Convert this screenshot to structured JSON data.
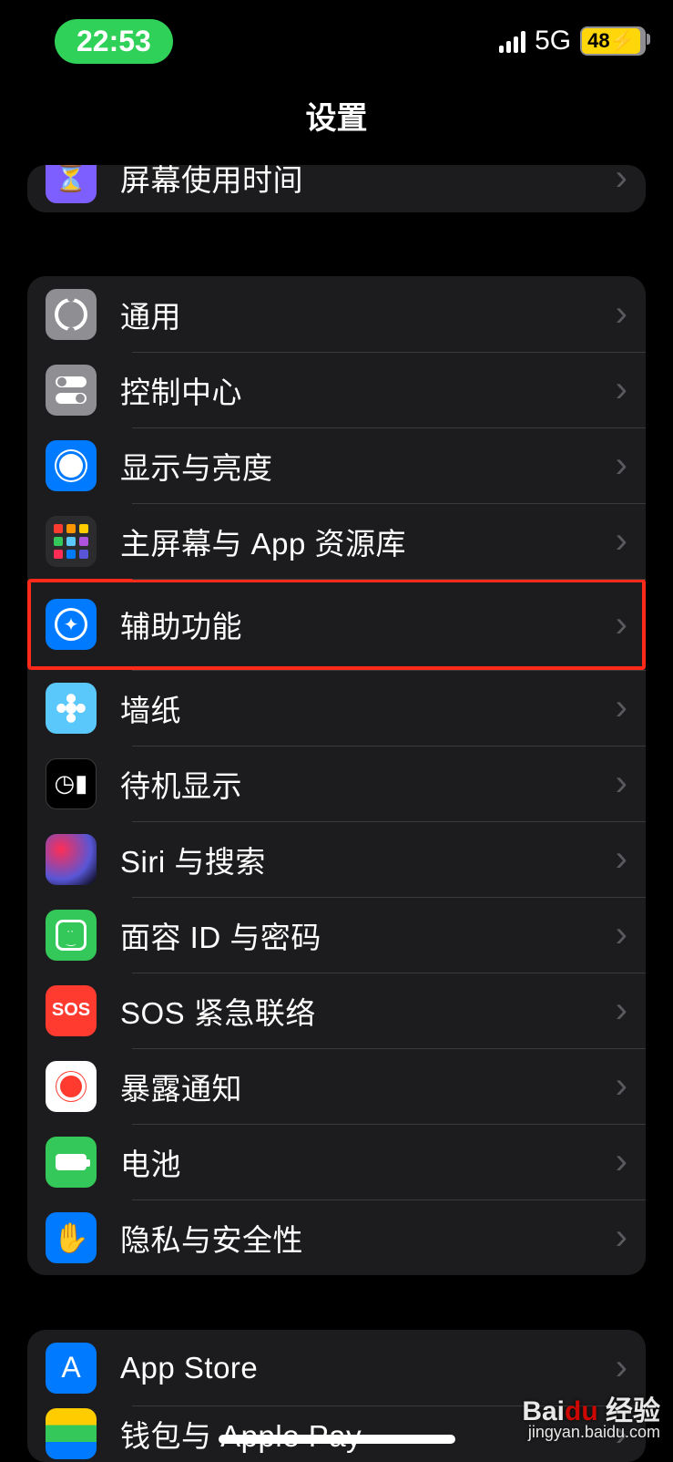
{
  "status": {
    "time": "22:53",
    "network": "5G",
    "battery_pct": "48"
  },
  "header": {
    "title": "设置"
  },
  "group0": {
    "item0": "屏幕使用时间"
  },
  "group1": {
    "item0": "通用",
    "item1": "控制中心",
    "item2": "显示与亮度",
    "item3": "主屏幕与 App 资源库",
    "item4": "辅助功能",
    "item5": "墙纸",
    "item6": "待机显示",
    "item7": "Siri 与搜索",
    "item8": "面容 ID 与密码",
    "item9": "SOS 紧急联络",
    "item10": "暴露通知",
    "item11": "电池",
    "item12": "隐私与安全性"
  },
  "group2": {
    "item0": "App Store",
    "item1": "钱包与 Apple Pay"
  },
  "highlight_index": 4,
  "watermark": {
    "brand_a": "Bai",
    "brand_b": "du",
    "brand_c": "经验",
    "url": "jingyan.baidu.com"
  }
}
